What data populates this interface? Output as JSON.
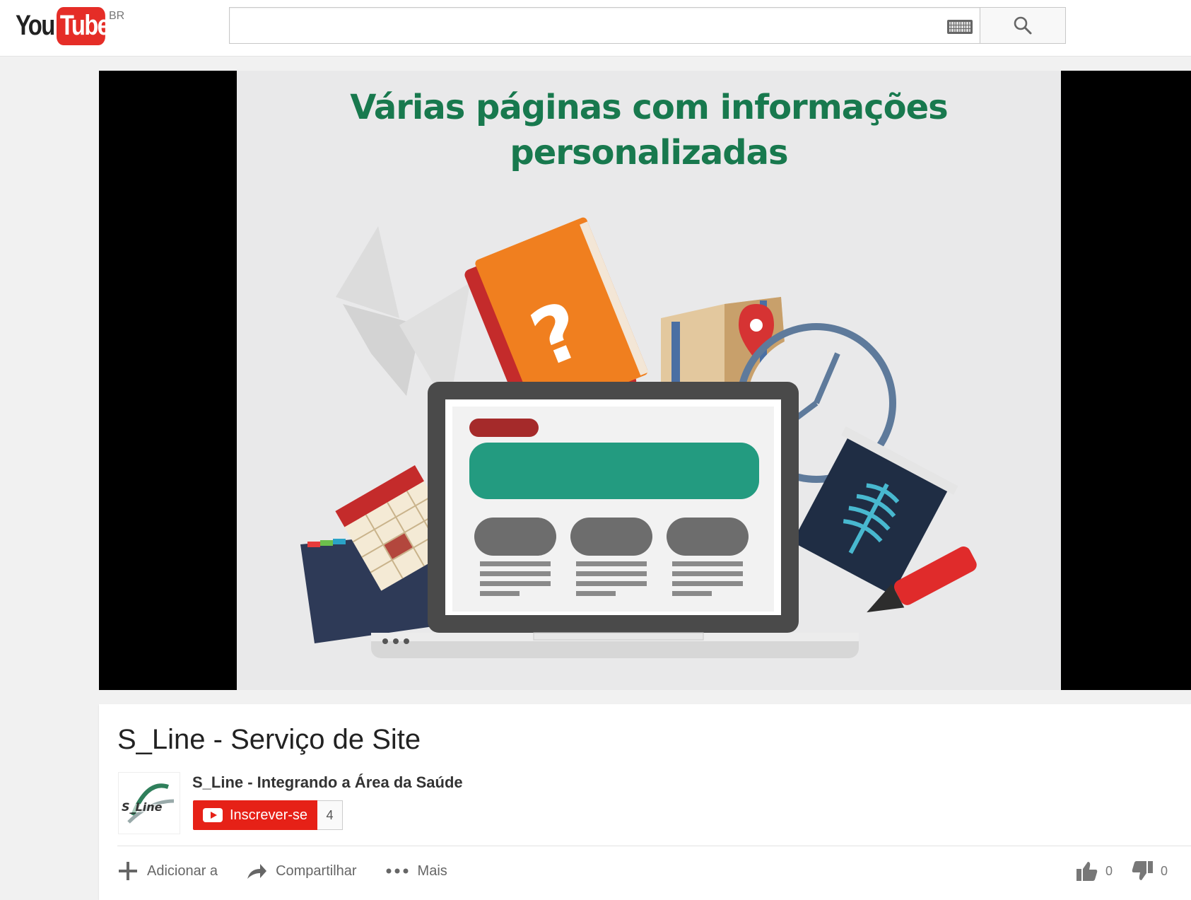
{
  "masthead": {
    "logo_you": "You",
    "logo_tube": "Tube",
    "region": "BR",
    "search_value": "",
    "search_placeholder": ""
  },
  "slide": {
    "title_line1": "Várias páginas com informações",
    "title_line2": "personalizadas"
  },
  "video": {
    "title": "S_Line - Serviço de Site",
    "owner_name": "S_Line - Integrando a Área da Saúde",
    "subscribe_label": "Inscrever-se",
    "subscriber_count": "4"
  },
  "actions": {
    "add_label": "Adicionar a",
    "share_label": "Compartilhar",
    "more_label": "Mais",
    "likes": "0",
    "dislikes": "0"
  },
  "colors": {
    "brand_red": "#e52d27",
    "subscribe_red": "#e62117",
    "slide_title_green": "#18794e",
    "banner_teal": "#239b80"
  }
}
